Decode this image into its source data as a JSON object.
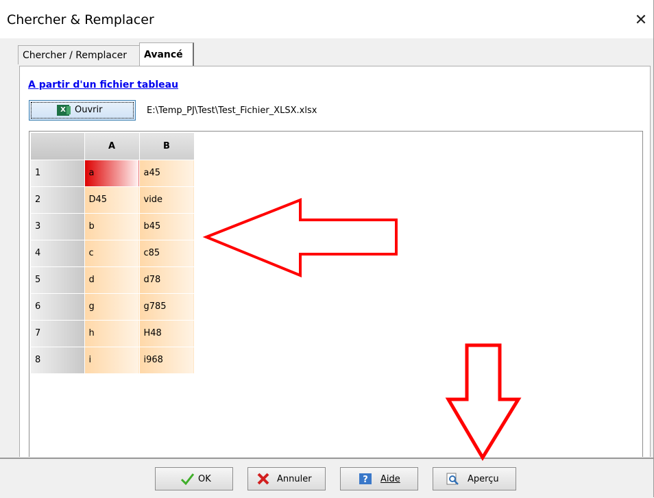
{
  "window": {
    "title": "Chercher & Remplacer",
    "close_symbol": "✕"
  },
  "tabs": [
    {
      "label": "Chercher / Remplacer",
      "active": false
    },
    {
      "label": "Avancé",
      "active": true
    }
  ],
  "panel": {
    "link_text": "A partir d'un fichier tableau",
    "open_button_label": "Ouvrir",
    "open_button_icon": "excel-icon",
    "file_path": "E:\\Temp_PJ\\Test\\Test_Fichier_XLSX.xlsx"
  },
  "grid": {
    "columns": [
      "A",
      "B"
    ],
    "rows": [
      {
        "num": "1",
        "a": "a",
        "b": "a45"
      },
      {
        "num": "2",
        "a": "D45",
        "b": "vide"
      },
      {
        "num": "3",
        "a": "b",
        "b": "b45"
      },
      {
        "num": "4",
        "a": "c",
        "b": "c85"
      },
      {
        "num": "5",
        "a": "d",
        "b": "d78"
      },
      {
        "num": "6",
        "a": "g",
        "b": "g785"
      },
      {
        "num": "7",
        "a": "h",
        "b": "H48"
      },
      {
        "num": "8",
        "a": "i",
        "b": "i968"
      }
    ]
  },
  "footer": {
    "ok_label": "OK",
    "cancel_label": "Annuler",
    "help_label": "Aide",
    "preview_label": "Aperçu"
  },
  "colors": {
    "annotation_arrow": "#ff0000",
    "link": "#0000ee",
    "selected_cell": "#dd0000",
    "cell_fill": "#ffd8a8"
  }
}
